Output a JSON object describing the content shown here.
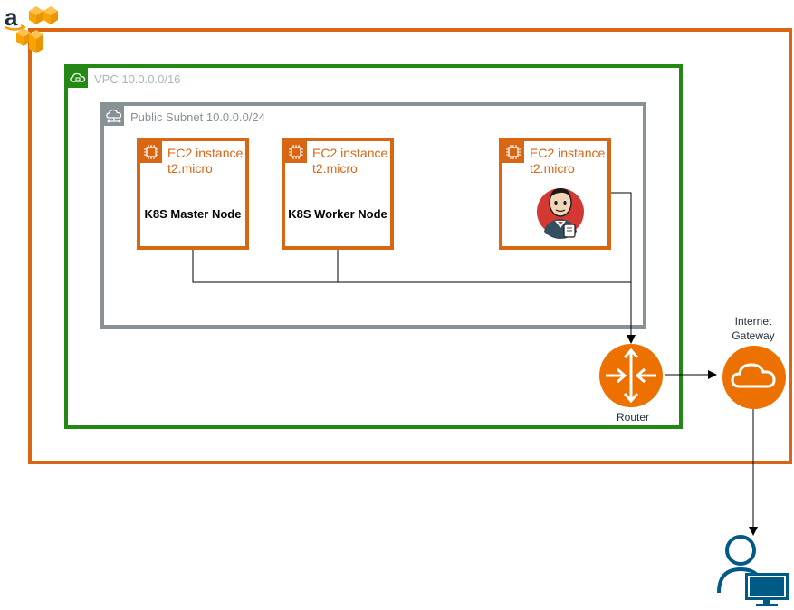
{
  "groups": {
    "vpc_label": "VPC 10.0.0.0/16",
    "subnet_label": "Public Subnet 10.0.0.0/24"
  },
  "instances": [
    {
      "type_label": "EC2 instance",
      "size_label": "t2.micro",
      "name": "K8S Master Node",
      "icon": "ec2-chip-icon"
    },
    {
      "type_label": "EC2 instance",
      "size_label": "t2.micro",
      "name": "K8S Worker Node",
      "icon": "ec2-chip-icon"
    },
    {
      "type_label": "EC2 instance",
      "size_label": "t2.micro",
      "name": "",
      "icon": "jenkins-logo"
    }
  ],
  "router": {
    "label": "Router",
    "icon": "router-icon"
  },
  "gateway": {
    "label_line1": "Internet",
    "label_line2": "Gateway",
    "icon": "internet-gateway-icon"
  },
  "client": {
    "icon": "user-computer-icon"
  },
  "colors": {
    "aws_orange": "#d86613",
    "vpc_green": "#248814",
    "subnet_gray": "#879196",
    "router_orange": "#ed7100",
    "client_blue": "#005a86"
  }
}
